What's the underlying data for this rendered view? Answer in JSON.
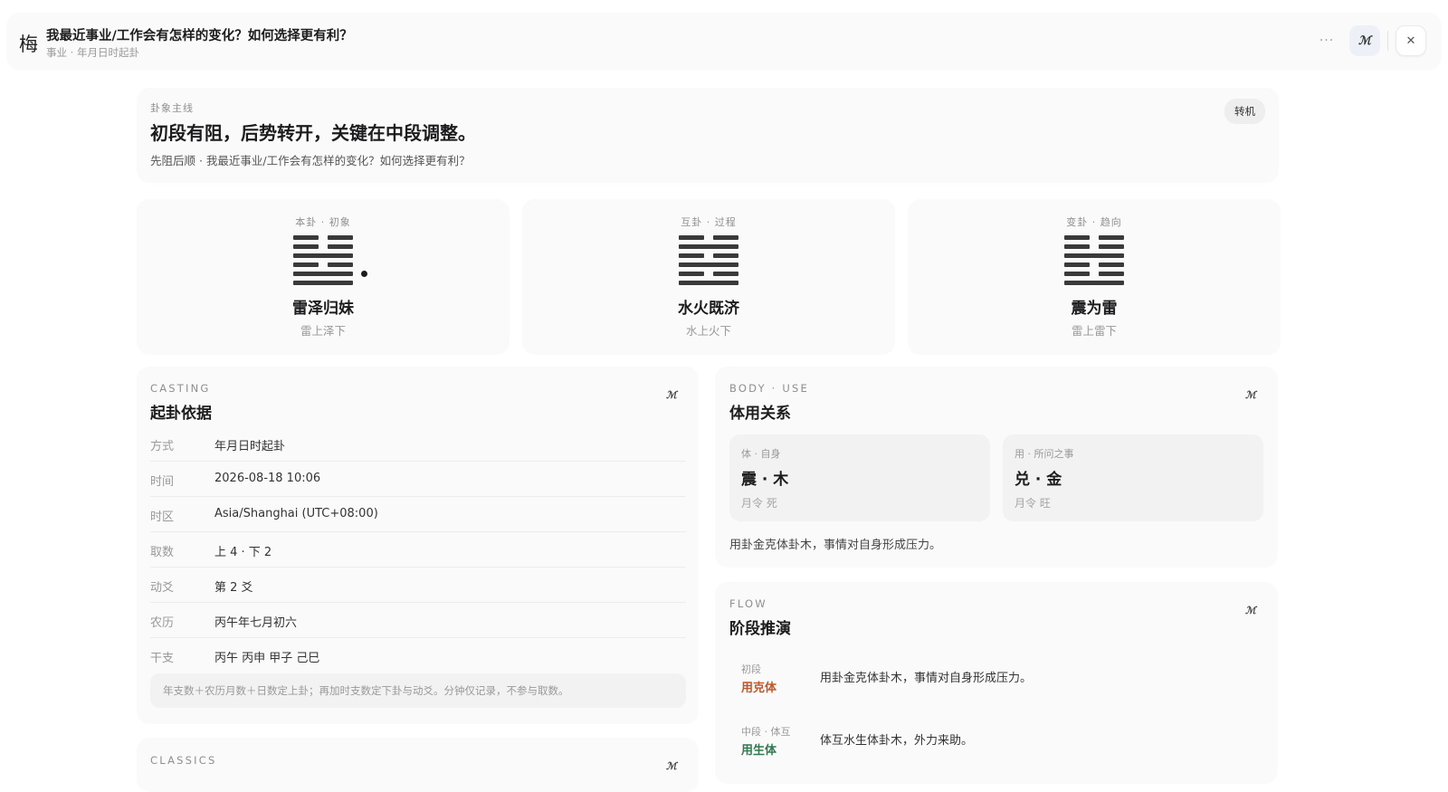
{
  "header": {
    "app_glyph": "梅",
    "question": "我最近事业/工作会有怎样的变化？如何选择更有利？",
    "meta": "事业 · 年月日时起卦",
    "more_label": "···",
    "ai_label": "ℳ",
    "close_label": "✕"
  },
  "summary": {
    "eyebrow": "卦象主线",
    "headline": "初段有阻，后势转开，关键在中段调整。",
    "desc": "先阻后顺 · 我最近事业/工作会有怎样的变化？如何选择更有利？",
    "badge": "转机"
  },
  "hexagrams": [
    {
      "eyebrow": "本卦 · 初象",
      "name": "雷泽归妹",
      "sub": "雷上泽下",
      "lines_top_to_bottom": [
        "yin",
        "yin",
        "yang",
        "yin",
        "yang",
        "yang"
      ],
      "moving_line_from_bottom": 2
    },
    {
      "eyebrow": "互卦 · 过程",
      "name": "水火既济",
      "sub": "水上火下",
      "lines_top_to_bottom": [
        "yin",
        "yang",
        "yin",
        "yang",
        "yin",
        "yang"
      ],
      "moving_line_from_bottom": null
    },
    {
      "eyebrow": "变卦 · 趋向",
      "name": "震为雷",
      "sub": "雷上雷下",
      "lines_top_to_bottom": [
        "yin",
        "yin",
        "yang",
        "yin",
        "yin",
        "yang"
      ],
      "moving_line_from_bottom": null
    }
  ],
  "casting": {
    "eyebrow": "CASTING",
    "title": "起卦依据",
    "ai_label": "ℳ",
    "rows": [
      {
        "k": "方式",
        "v": "年月日时起卦"
      },
      {
        "k": "时间",
        "v": "2026-08-18 10:06"
      },
      {
        "k": "时区",
        "v": "Asia/Shanghai (UTC+08:00)"
      },
      {
        "k": "取数",
        "v": "上 4 · 下 2"
      },
      {
        "k": "动爻",
        "v": "第 2 爻"
      },
      {
        "k": "农历",
        "v": "丙午年七月初六"
      },
      {
        "k": "干支",
        "v": "丙午 丙申 甲子 己巳"
      }
    ],
    "note": "年支数＋农历月数＋日数定上卦；再加时支数定下卦与动爻。分钟仅记录，不参与取数。"
  },
  "body_use": {
    "eyebrow": "BODY · USE",
    "title": "体用关系",
    "ai_label": "ℳ",
    "body": {
      "label": "体 · 自身",
      "value": "震 · 木",
      "status": "月令 死"
    },
    "use": {
      "label": "用 · 所问之事",
      "value": "兑 · 金",
      "status": "月令 旺"
    },
    "conclusion": "用卦金克体卦木，事情对自身形成压力。"
  },
  "flow": {
    "eyebrow": "FLOW",
    "title": "阶段推演",
    "ai_label": "ℳ",
    "stages": [
      {
        "label": "初段",
        "relation": "用克体",
        "color": "#c0562a",
        "text": "用卦金克体卦木，事情对自身形成压力。"
      },
      {
        "label": "中段 · 体互",
        "relation": "用生体",
        "color": "#2f7a4f",
        "text": "体互水生体卦木，外力来助。"
      }
    ]
  },
  "classics": {
    "eyebrow": "CLASSICS",
    "ai_label": "ℳ"
  }
}
